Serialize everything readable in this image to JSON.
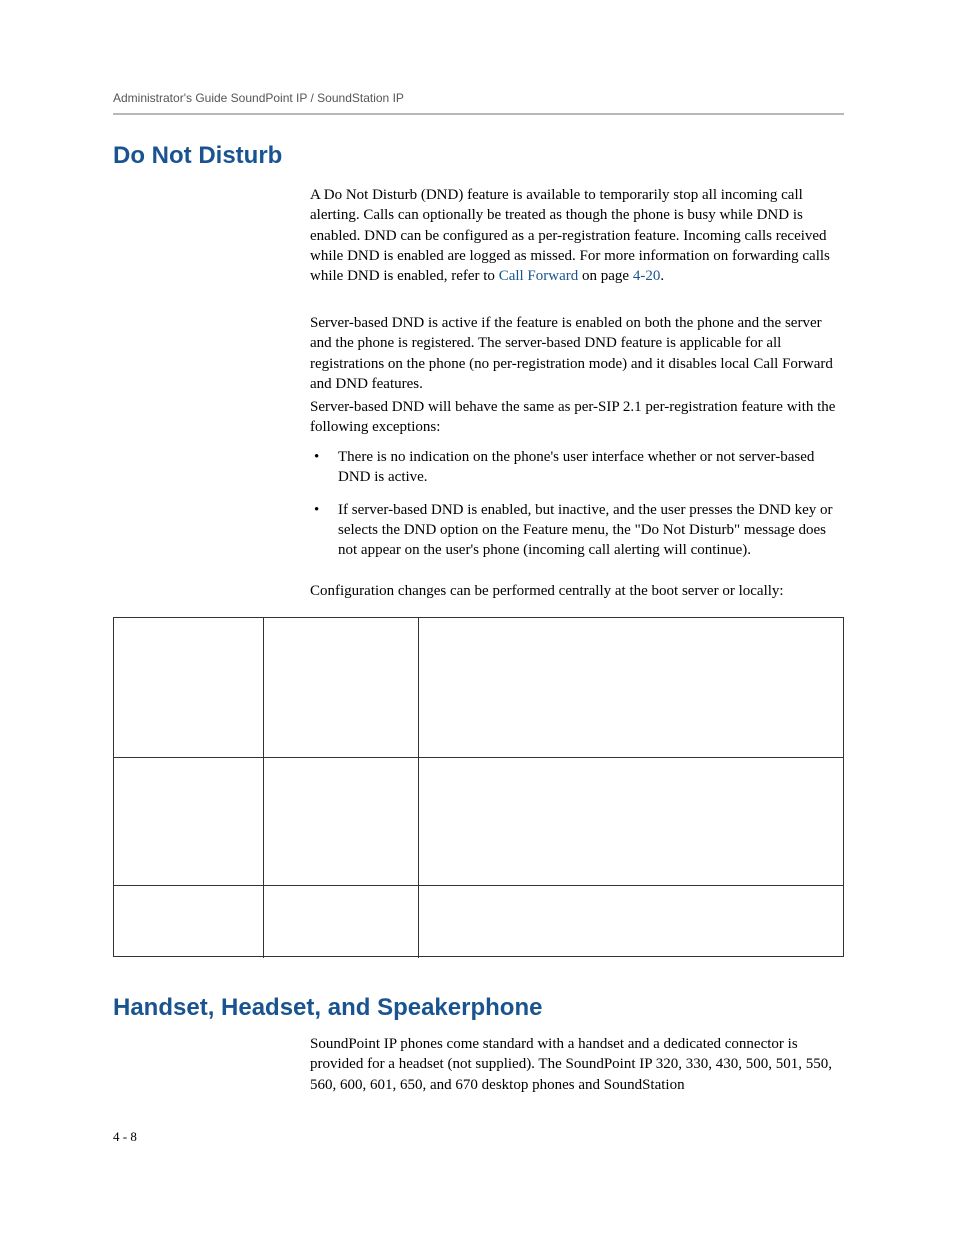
{
  "header": {
    "text": "Administrator's Guide SoundPoint IP / SoundStation IP"
  },
  "section1": {
    "heading": "Do Not Disturb",
    "para1_a": "A Do Not Disturb (DND) feature is available to temporarily stop all incoming call alerting. Calls can optionally be treated as though the phone is busy while DND is enabled. DND can be configured as a per-registration feature. Incoming calls received while DND is enabled are logged as missed. For more information on forwarding calls while DND is enabled, refer to ",
    "para1_link1": "Call Forward",
    "para1_b": " on page ",
    "para1_link2": "4-20",
    "para1_c": ".",
    "para2": "Server-based DND is active if the feature is enabled on both the phone and the server and the phone is registered. The server-based DND feature is applicable for all registrations on the phone (no per-registration mode) and it disables local Call Forward and DND features.",
    "para3": "Server-based DND will behave the same as per-SIP 2.1 per-registration feature with the following exceptions:",
    "bullets": [
      "There is no indication on the phone's user interface whether or not server-based DND is active.",
      "If server-based DND is enabled, but inactive, and the user presses the DND key or selects the DND option on the Feature menu, the \"Do Not Disturb\" message does not appear on the user's phone (incoming call alerting will continue)."
    ],
    "para4": "Configuration changes can be performed centrally at the boot server or locally:"
  },
  "section2": {
    "heading": "Handset, Headset, and Speakerphone",
    "para1": "SoundPoint IP phones come standard with a handset and a dedicated connector is provided for a headset (not supplied). The SoundPoint IP 320, 330, 430, 500, 501, 550, 560, 600, 601, 650, and 670 desktop phones and SoundStation"
  },
  "footer": {
    "pagenum": "4 - 8"
  },
  "table": {
    "rows": [
      {
        "c1": "",
        "c2": "",
        "c3": ""
      },
      {
        "c1": "",
        "c2": "",
        "c3": ""
      },
      {
        "c1": "",
        "c2": "",
        "c3": ""
      }
    ]
  }
}
